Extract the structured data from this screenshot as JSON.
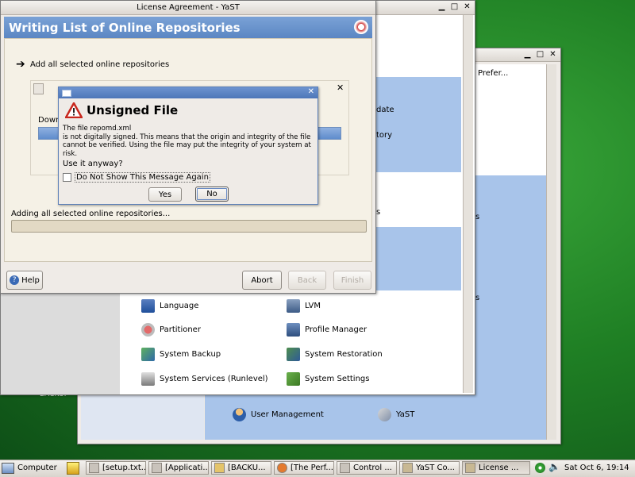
{
  "desktop": {
    "label_backup": "BACKUP"
  },
  "control_center": {
    "pref_text": "Prefer...",
    "side_frag_1": "date",
    "side_frag_2": "tory",
    "side_frag_3": "s",
    "side_frag_4": "s",
    "side_frag_5": "s",
    "items": [
      {
        "label": "Language",
        "icon": "language-icon"
      },
      {
        "label": "LVM",
        "icon": "lvm-icon"
      },
      {
        "label": "Partitioner",
        "icon": "partitioner-icon"
      },
      {
        "label": "Profile Manager",
        "icon": "profile-manager-icon"
      },
      {
        "label": "System Backup",
        "icon": "system-backup-icon"
      },
      {
        "label": "System Restoration",
        "icon": "system-restoration-icon"
      },
      {
        "label": "System Services (Runlevel)",
        "icon": "system-services-icon"
      },
      {
        "label": "System Settings",
        "icon": "system-settings-icon"
      }
    ],
    "groups": [
      {
        "label": "User Management",
        "icon": "user-management-icon"
      },
      {
        "label": "YaST",
        "icon": "yast-icon"
      }
    ]
  },
  "yast_window": {
    "title": "License Agreement - YaST",
    "header": "Writing List of Online Repositories",
    "step": "Add all selected online repositories",
    "download_label": "Down",
    "progress_label": "Adding all selected online repositories...",
    "progress_value": 0,
    "help": "Help",
    "abort": "Abort",
    "back": "Back",
    "finish": "Finish"
  },
  "dialog": {
    "title": "Unsigned File",
    "message": "The file repomd.xml\nis not digitally signed. This means that the origin and integrity of the file\ncannot be verified. Using the file may put the integrity of your system at risk.",
    "question": "Use it anyway?",
    "checkbox": "Do Not Show This Message Again",
    "checkbox_checked": false,
    "yes": "Yes",
    "no": "No"
  },
  "taskbar": {
    "computer": "Computer",
    "tasks": [
      "[setup.txt...",
      "[Applicati...",
      "[BACKU...",
      "[The Perf...",
      "Control ...",
      "YaST Co...",
      "License ..."
    ],
    "clock": "Sat Oct 6, 19:14"
  }
}
